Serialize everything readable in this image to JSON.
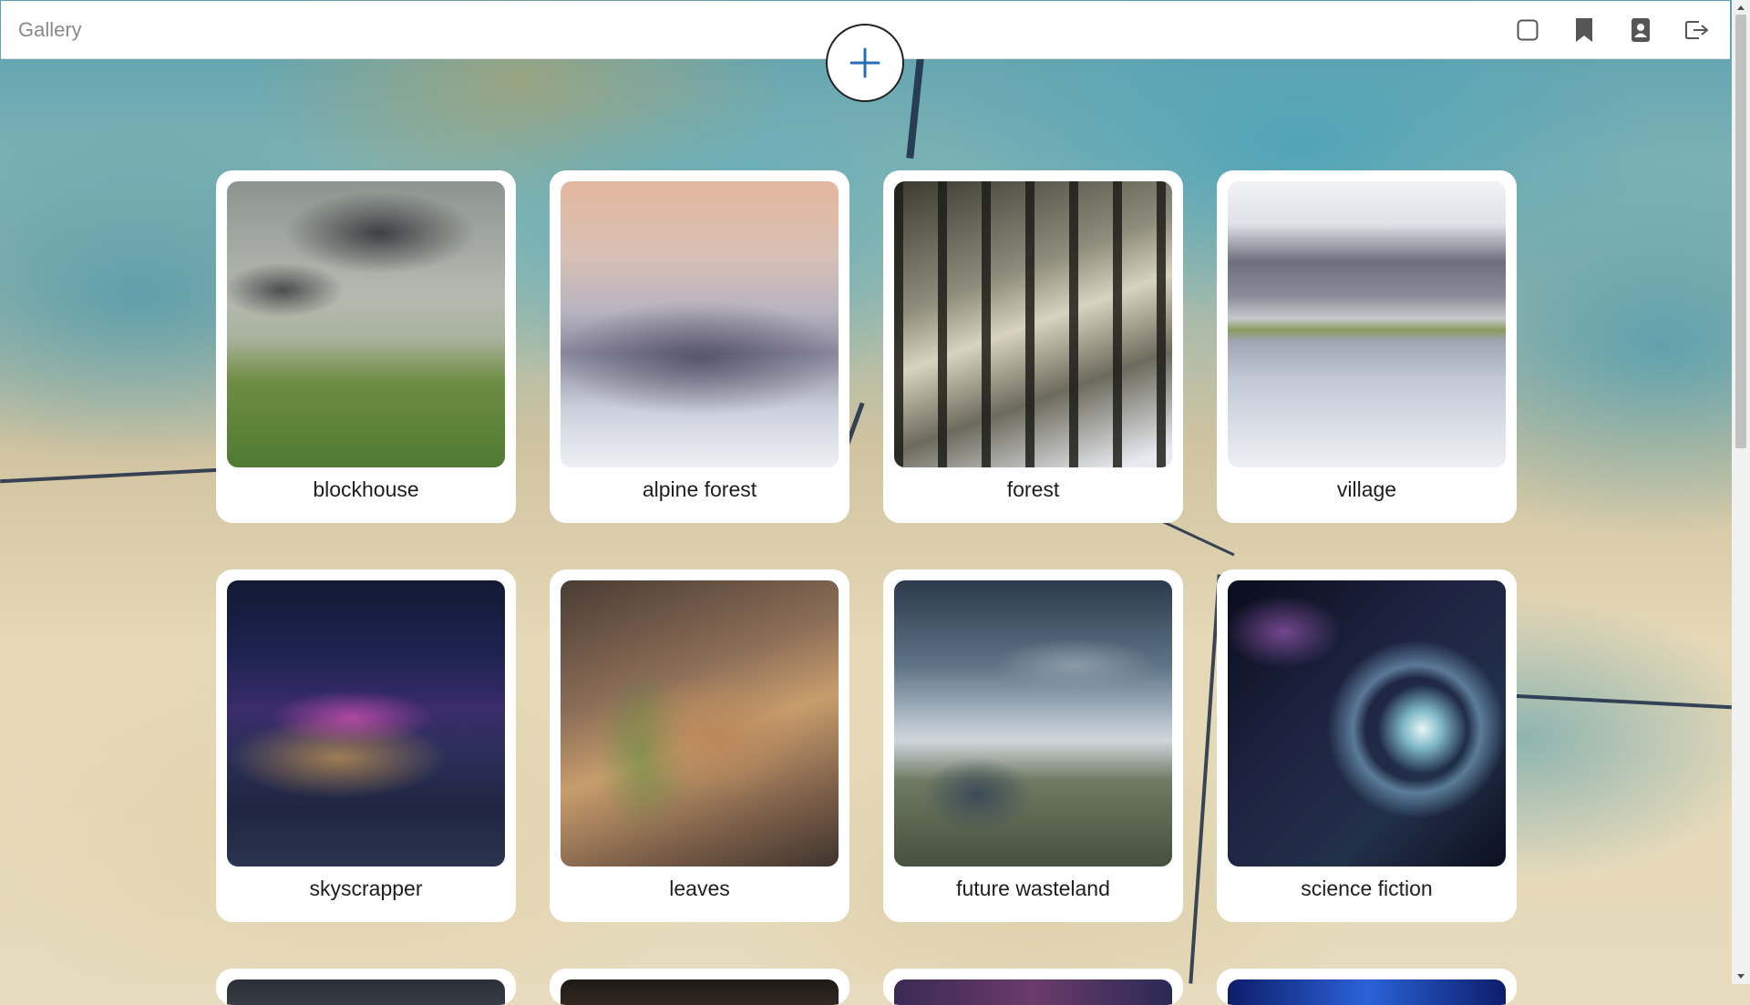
{
  "app": {
    "title": "Gallery"
  },
  "nav": {
    "icons": [
      {
        "name": "square-icon"
      },
      {
        "name": "bookmark-icon"
      },
      {
        "name": "contact-book-icon"
      },
      {
        "name": "logout-icon"
      }
    ]
  },
  "actions": {
    "add_icon": "plus-icon"
  },
  "gallery": {
    "items": [
      {
        "title": "blockhouse"
      },
      {
        "title": "alpine forest"
      },
      {
        "title": "forest"
      },
      {
        "title": "village"
      },
      {
        "title": "skyscrapper"
      },
      {
        "title": "leaves"
      },
      {
        "title": "future wasteland"
      },
      {
        "title": "science fiction"
      }
    ]
  },
  "colors": {
    "accent": "#2a6db5",
    "card_bg": "#ffffff",
    "topbar_bg": "#ffffff"
  }
}
